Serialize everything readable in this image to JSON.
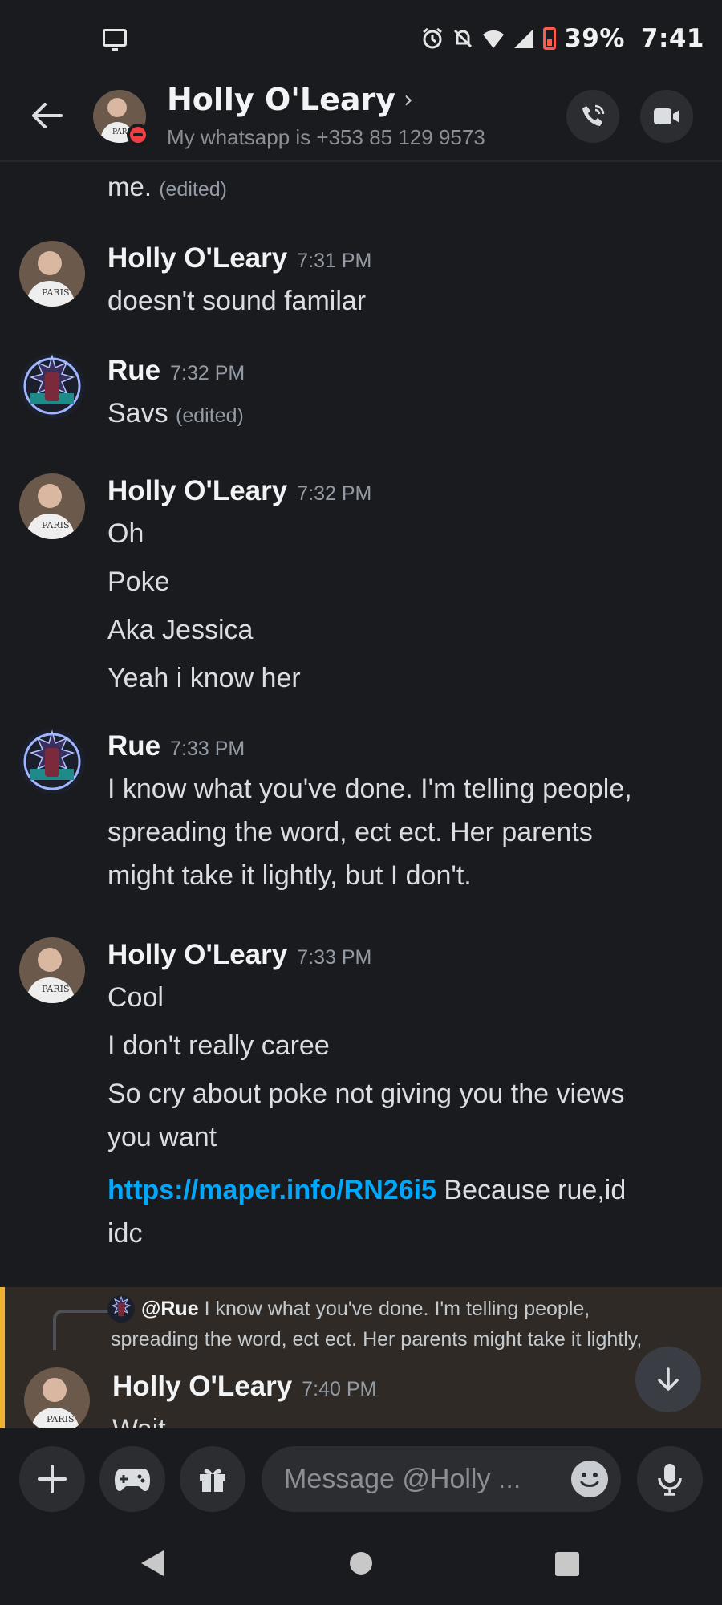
{
  "status_bar": {
    "battery": "39%",
    "time": "7:41"
  },
  "header": {
    "contact_name": "Holly O'Leary",
    "chevron": "›",
    "status_text": "My whatsapp is +353 85 129 9573"
  },
  "top_fragment": {
    "text": "me.",
    "edited": "(edited)"
  },
  "groups": [
    {
      "author": "Holly O'Leary",
      "time": "7:31 PM",
      "lines": [
        "doesn't sound familar"
      ]
    },
    {
      "author": "Rue",
      "time": "7:32 PM",
      "lines": [
        "Savs"
      ],
      "edited": "(edited)"
    },
    {
      "author": "Holly O'Leary",
      "time": "7:32 PM",
      "lines": [
        "Oh",
        "Poke",
        "Aka Jessica",
        "Yeah i know her"
      ]
    },
    {
      "author": "Rue",
      "time": "7:33 PM",
      "lines": [
        "I know what you've done. I'm telling people,",
        "spreading the word, ect ect. Her parents",
        "might take it lightly, but I don't."
      ]
    },
    {
      "author": "Holly O'Leary",
      "time": "7:33 PM",
      "lines": [
        "Cool",
        "I don't really caree",
        "So cry about poke not giving you the views",
        "you want"
      ],
      "link": "https://maper.info/RN26i5",
      "link_suffix": " Because rue,id",
      "after_link": "idc"
    }
  ],
  "reply": {
    "mention": "@Rue",
    "preview_line1": "I know what you've done. I'm telling people,",
    "preview_line2": "spreading the word, ect ect. Her parents might take it lightly,",
    "author": "Holly O'Leary",
    "time": "7:40 PM",
    "text": "Wait"
  },
  "composer": {
    "placeholder": "Message @Holly ..."
  },
  "icons": [
    "back-arrow-icon",
    "phone-icon",
    "video-icon",
    "plus-icon",
    "gamepad-icon",
    "gift-icon",
    "emoji-icon",
    "microphone-icon",
    "chevron-down-icon"
  ],
  "colors": {
    "background": "#1a1b1f",
    "link": "#00a8fc",
    "dnd": "#f23f43",
    "reply_highlight": "#f0b232"
  }
}
